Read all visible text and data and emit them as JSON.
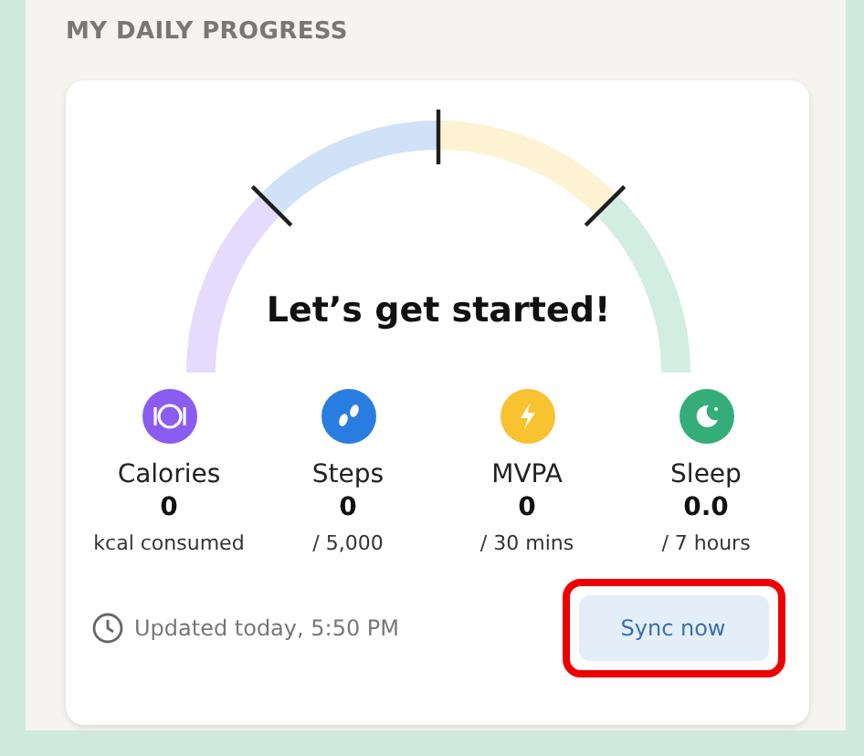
{
  "section_title": "MY DAILY PROGRESS",
  "gauge": {
    "message": "Let’s get started!"
  },
  "stats": [
    {
      "label": "Calories",
      "value": "0",
      "target": "kcal consumed",
      "color": "#8a5cf0",
      "kind": "calories"
    },
    {
      "label": "Steps",
      "value": "0",
      "target": "/ 5,000",
      "color": "#2a7de0",
      "kind": "steps"
    },
    {
      "label": "MVPA",
      "value": "0",
      "target": "/ 30 mins",
      "color": "#f8c230",
      "kind": "mvpa"
    },
    {
      "label": "Sleep",
      "value": "0.0",
      "target": "/ 7 hours",
      "color": "#34ad78",
      "kind": "sleep"
    }
  ],
  "updated": "Updated today, 5:50 PM",
  "sync_button": {
    "label": "Sync now",
    "highlighted": true
  }
}
